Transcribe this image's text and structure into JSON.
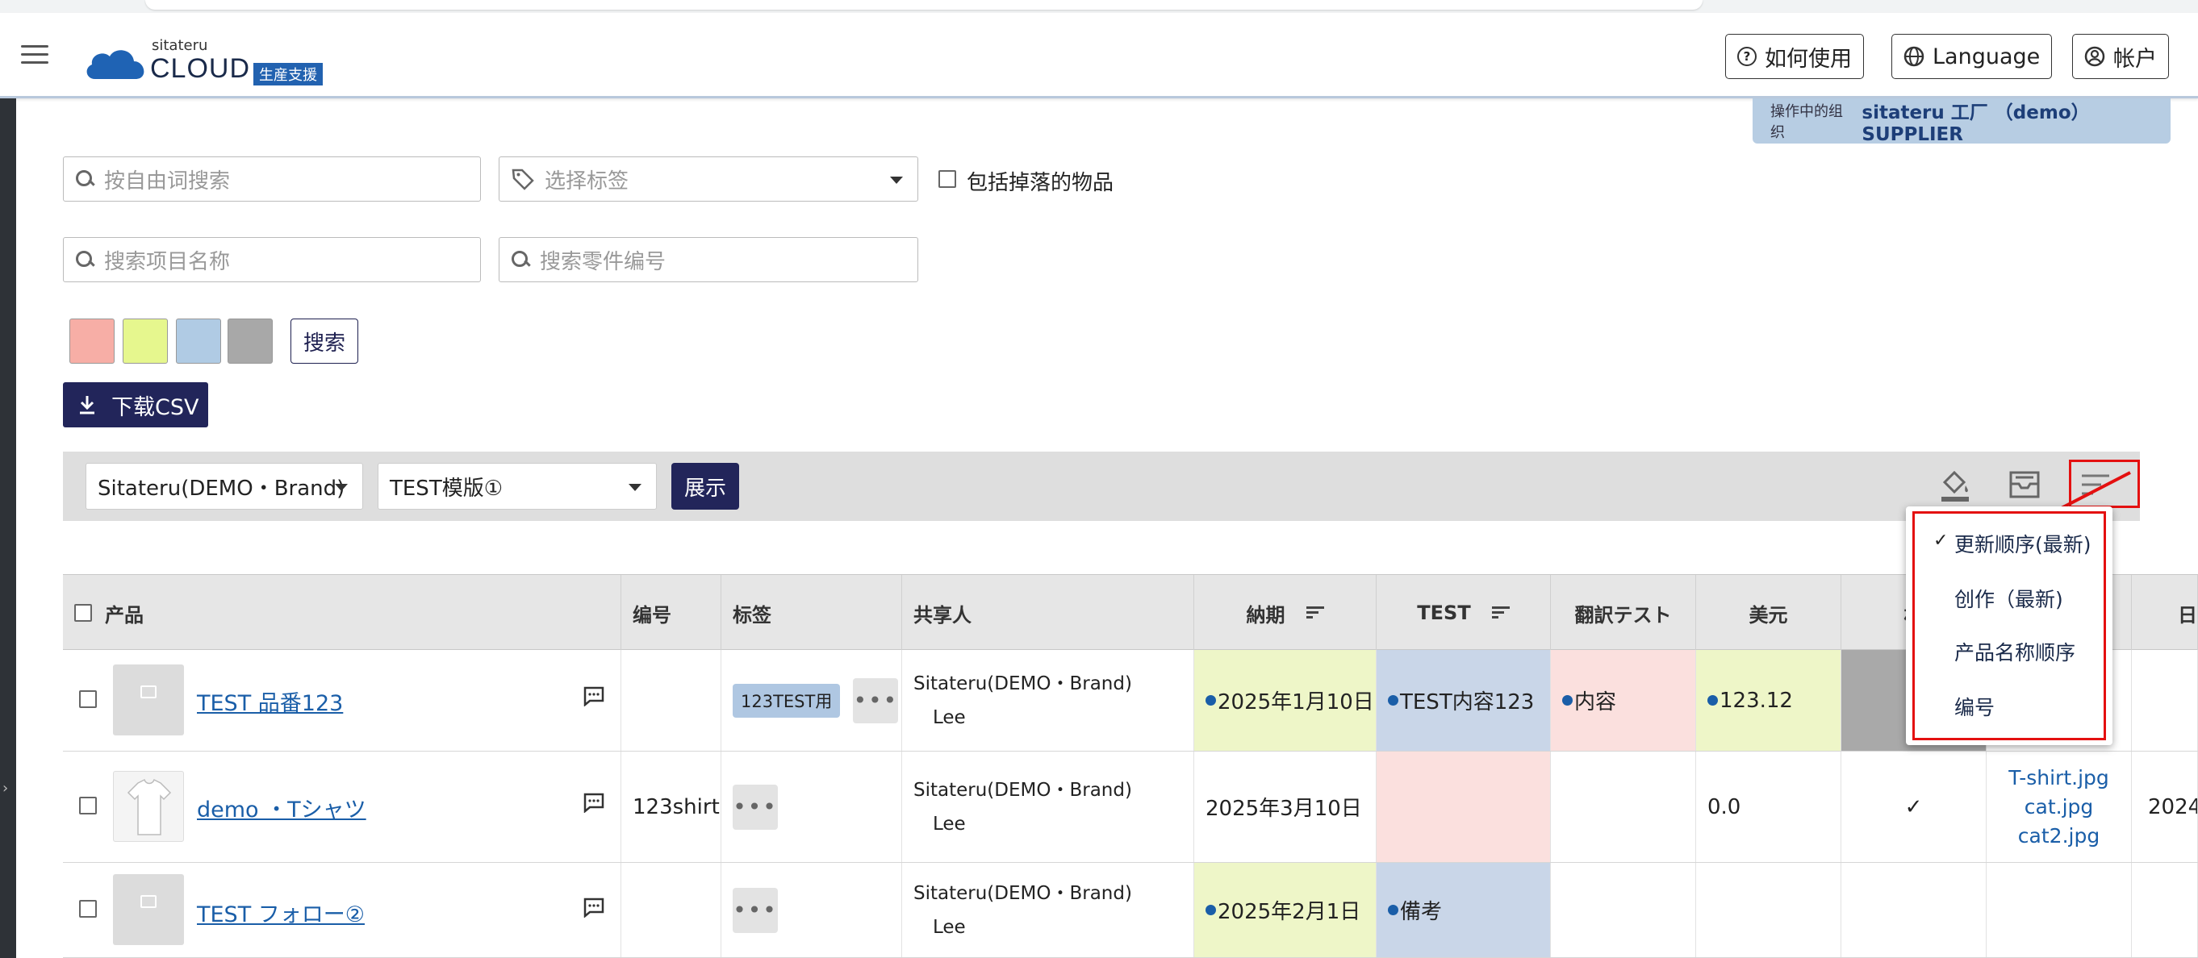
{
  "header": {
    "logo_small": "sitateru",
    "logo_big": "CLOUD",
    "logo_badge": "生産支援",
    "help_label": "如何使用",
    "language_label": "Language",
    "account_label": "帐户"
  },
  "org": {
    "label": "操作中的组织",
    "value": "sitateru 工厂 （demo） SUPPLIER"
  },
  "filters": {
    "freeword_placeholder": "按自由词搜索",
    "tag_placeholder": "选择标签",
    "include_dropped_label": "包括掉落的物品",
    "project_placeholder": "搜索项目名称",
    "part_placeholder": "搜索零件编号",
    "search_label": "搜索",
    "swatches": [
      "#f7aea6",
      "#e6f78e",
      "#b0cbe4",
      "#a8a8a8"
    ]
  },
  "csv_label": "下载CSV",
  "toolbar": {
    "brand_select": "Sitateru(DEMO・Brand)",
    "template_select": "TEST模版①",
    "show_label": "展示"
  },
  "sort_menu": {
    "items": [
      "更新顺序(最新)",
      "创作（最新)",
      "产品名称顺序",
      "编号"
    ],
    "selected_index": 0
  },
  "table": {
    "headers": [
      "产品",
      "编号",
      "标签",
      "共享人",
      "納期",
      "TEST",
      "翻訳テスト",
      "美元",
      "杉",
      "",
      "日"
    ],
    "rows": [
      {
        "product": "TEST 品番123",
        "code": "",
        "tag": "123TEST用",
        "share1": "Sitateru(DEMO・Brand)",
        "share2": "Lee",
        "deadline": "2025年1月10日",
        "test": "TEST内容123",
        "trans": "内容",
        "usd": "123.12",
        "check": "",
        "files": [],
        "date": ""
      },
      {
        "product": "demo ・Tシャツ",
        "code": "123shirt",
        "tag": "",
        "share1": "Sitateru(DEMO・Brand)",
        "share2": "Lee",
        "deadline": "2025年3月10日",
        "test": "",
        "trans": "",
        "usd": "0.0",
        "check": "✓",
        "files": [
          "T-shirt.jpg",
          "cat.jpg",
          "cat2.jpg"
        ],
        "date": "2024"
      },
      {
        "product": "TEST フォロー②",
        "code": "",
        "tag": "",
        "share1": "Sitateru(DEMO・Brand)",
        "share2": "Lee",
        "deadline": "2025年2月1日",
        "test": "備考",
        "trans": "",
        "usd": "",
        "check": "",
        "files": [],
        "date": ""
      }
    ]
  },
  "colors": {
    "navy": "#22255a",
    "link": "#1a5ea8",
    "cell_yellow": "#eef6c8",
    "cell_blue": "#c9d6e8",
    "cell_pink": "#fbe0de",
    "cell_gray": "#a9a9a9",
    "highlight_red": "#e41010"
  }
}
